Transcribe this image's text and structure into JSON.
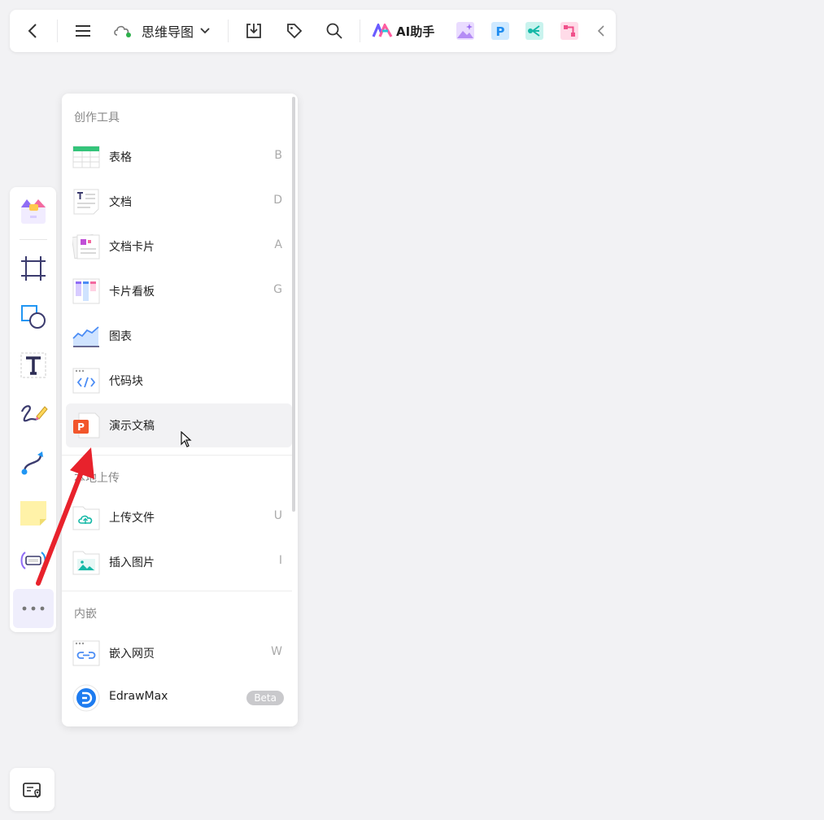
{
  "topbar": {
    "title": "思维导图",
    "ai_label": "AI助手"
  },
  "panel": {
    "sections": [
      {
        "title": "创作工具",
        "items": [
          {
            "label": "表格",
            "shortcut": "B"
          },
          {
            "label": "文档",
            "shortcut": "D"
          },
          {
            "label": "文档卡片",
            "shortcut": "A"
          },
          {
            "label": "卡片看板",
            "shortcut": "G"
          },
          {
            "label": "图表",
            "shortcut": ""
          },
          {
            "label": "代码块",
            "shortcut": ""
          },
          {
            "label": "演示文稿",
            "shortcut": ""
          }
        ]
      },
      {
        "title": "本地上传",
        "items": [
          {
            "label": "上传文件",
            "shortcut": "U"
          },
          {
            "label": "插入图片",
            "shortcut": "I"
          }
        ]
      },
      {
        "title": "内嵌",
        "items": [
          {
            "label": "嵌入网页",
            "shortcut": "W"
          },
          {
            "label": "EdrawMax",
            "badge": "Beta"
          }
        ]
      }
    ]
  },
  "colors": {
    "accent_red": "#e8222c",
    "hover_bg": "#f2f2f4",
    "more_bg": "#efeefc"
  }
}
